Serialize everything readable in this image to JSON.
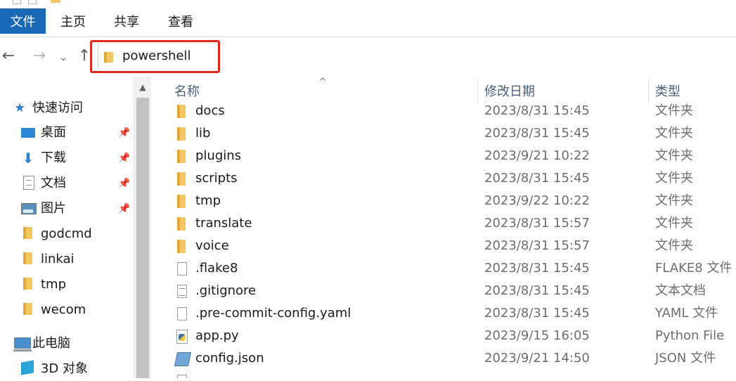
{
  "ribbon": {
    "tabs": [
      {
        "label": "文件",
        "active": true
      },
      {
        "label": "主页"
      },
      {
        "label": "共享"
      },
      {
        "label": "查看"
      }
    ]
  },
  "address": {
    "path": "powershell",
    "highlight_color": "#e0281e"
  },
  "nav_buttons": {
    "back_icon": "←",
    "forward_icon": "→",
    "recent_icon": "⌄",
    "up_icon": "↑"
  },
  "nav_pane": {
    "quick_access": {
      "label": "快速访问",
      "icon": "★"
    },
    "pinned": [
      {
        "label": "桌面",
        "icon": "desktop-icon"
      },
      {
        "label": "下载",
        "icon": "download-icon"
      },
      {
        "label": "文档",
        "icon": "documents-icon"
      },
      {
        "label": "图片",
        "icon": "pictures-icon"
      }
    ],
    "pin_icon": "📌",
    "folders": [
      {
        "label": "godcmd"
      },
      {
        "label": "linkai"
      },
      {
        "label": "tmp"
      },
      {
        "label": "wecom"
      }
    ],
    "this_pc": {
      "label": "此电脑"
    },
    "objects_3d": {
      "label": "3D 对象"
    }
  },
  "scrollbar": {
    "up_icon": "▲"
  },
  "file_list": {
    "sort_icon": "^",
    "columns": {
      "name": "名称",
      "date": "修改日期",
      "type": "类型"
    },
    "rows": [
      {
        "name": "docs",
        "date": "2023/8/31 15:45",
        "type": "文件夹",
        "icon": "folder"
      },
      {
        "name": "lib",
        "date": "2023/8/31 15:45",
        "type": "文件夹",
        "icon": "folder"
      },
      {
        "name": "plugins",
        "date": "2023/9/21 10:22",
        "type": "文件夹",
        "icon": "folder"
      },
      {
        "name": "scripts",
        "date": "2023/8/31 15:45",
        "type": "文件夹",
        "icon": "folder"
      },
      {
        "name": "tmp",
        "date": "2023/9/22 10:22",
        "type": "文件夹",
        "icon": "folder"
      },
      {
        "name": "translate",
        "date": "2023/8/31 15:57",
        "type": "文件夹",
        "icon": "folder"
      },
      {
        "name": "voice",
        "date": "2023/8/31 15:57",
        "type": "文件夹",
        "icon": "folder"
      },
      {
        "name": ".flake8",
        "date": "2023/8/31 15:45",
        "type": "FLAKE8 文件",
        "icon": "file"
      },
      {
        "name": ".gitignore",
        "date": "2023/8/31 15:45",
        "type": "文本文档",
        "icon": "text"
      },
      {
        "name": ".pre-commit-config.yaml",
        "date": "2023/8/31 15:45",
        "type": "YAML 文件",
        "icon": "file"
      },
      {
        "name": "app.py",
        "date": "2023/9/15 16:05",
        "type": "Python File",
        "icon": "python"
      },
      {
        "name": "config.json",
        "date": "2023/9/21 14:50",
        "type": "JSON 文件",
        "icon": "json"
      }
    ]
  },
  "colors": {
    "ribbon_active": "#1a67b3",
    "folder": "#f2c660",
    "header_text": "#4c607a"
  }
}
